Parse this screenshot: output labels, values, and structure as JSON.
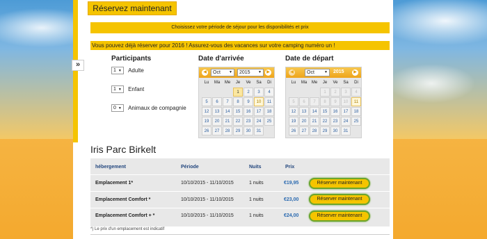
{
  "tab_label": "Réservez maintenant",
  "toggle_icon": "»",
  "band1_text": "Choisissez votre période de séjour pour les disponibilités et prix",
  "band2_text": "Vous pouvez déjà réserver pour 2016 ! Assurez-vous des vacances sur votre camping numéro un !",
  "participants": {
    "title": "Participants",
    "rows": [
      {
        "value": "1",
        "label": "Adulte"
      },
      {
        "value": "1",
        "label": "Enfant"
      },
      {
        "value": "0",
        "label": "Animaux de compagnie"
      }
    ]
  },
  "arrival": {
    "title": "Date d'arrivée",
    "month": "Oct",
    "year": "2015",
    "dows": [
      "Lu",
      "Ma",
      "Me",
      "Je",
      "Ve",
      "Sa",
      "Di"
    ],
    "cells": [
      "",
      "",
      "",
      "1",
      "2",
      "3",
      "4",
      "5",
      "6",
      "7",
      "8",
      "9",
      "10",
      "11",
      "12",
      "13",
      "14",
      "15",
      "16",
      "17",
      "18",
      "19",
      "20",
      "21",
      "22",
      "23",
      "24",
      "25",
      "26",
      "27",
      "28",
      "29",
      "30",
      "31",
      ""
    ]
  },
  "departure": {
    "title": "Date de départ",
    "month": "Oct",
    "year": "2015",
    "dows": [
      "Lu",
      "Ma",
      "Me",
      "Je",
      "Ve",
      "Sa",
      "Di"
    ],
    "cells": [
      "",
      "",
      "",
      "1",
      "2",
      "3",
      "4",
      "5",
      "6",
      "7",
      "8",
      "9",
      "10",
      "11",
      "12",
      "13",
      "14",
      "15",
      "16",
      "17",
      "18",
      "19",
      "20",
      "21",
      "22",
      "23",
      "24",
      "25",
      "26",
      "27",
      "28",
      "29",
      "30",
      "31",
      ""
    ]
  },
  "campsite_name": "Iris Parc Birkelt",
  "table": {
    "headers": [
      "hébergement",
      "Période",
      "Nuits",
      "Prix"
    ],
    "rows": [
      {
        "name": "Emplacement 1*",
        "period": "10/10/2015 - 11/10/2015",
        "nights": "1 nuits",
        "price": "€19,95",
        "button": "Réserver maintenant"
      },
      {
        "name": "Emplacement Comfort *",
        "period": "10/10/2015 - 11/10/2015",
        "nights": "1 nuits",
        "price": "€23,00",
        "button": "Réserver maintenant"
      },
      {
        "name": "Emplacement Comfort + *",
        "period": "10/10/2015 - 11/10/2015",
        "nights": "1 nuits",
        "price": "€24,00",
        "button": "Réserver maintenant"
      }
    ]
  },
  "footnote": "*) Le prix d'un emplacement est indicatif",
  "colors": {
    "accent": "#f5c400",
    "link": "#2b6ab0",
    "button_border": "#6ca52d"
  }
}
